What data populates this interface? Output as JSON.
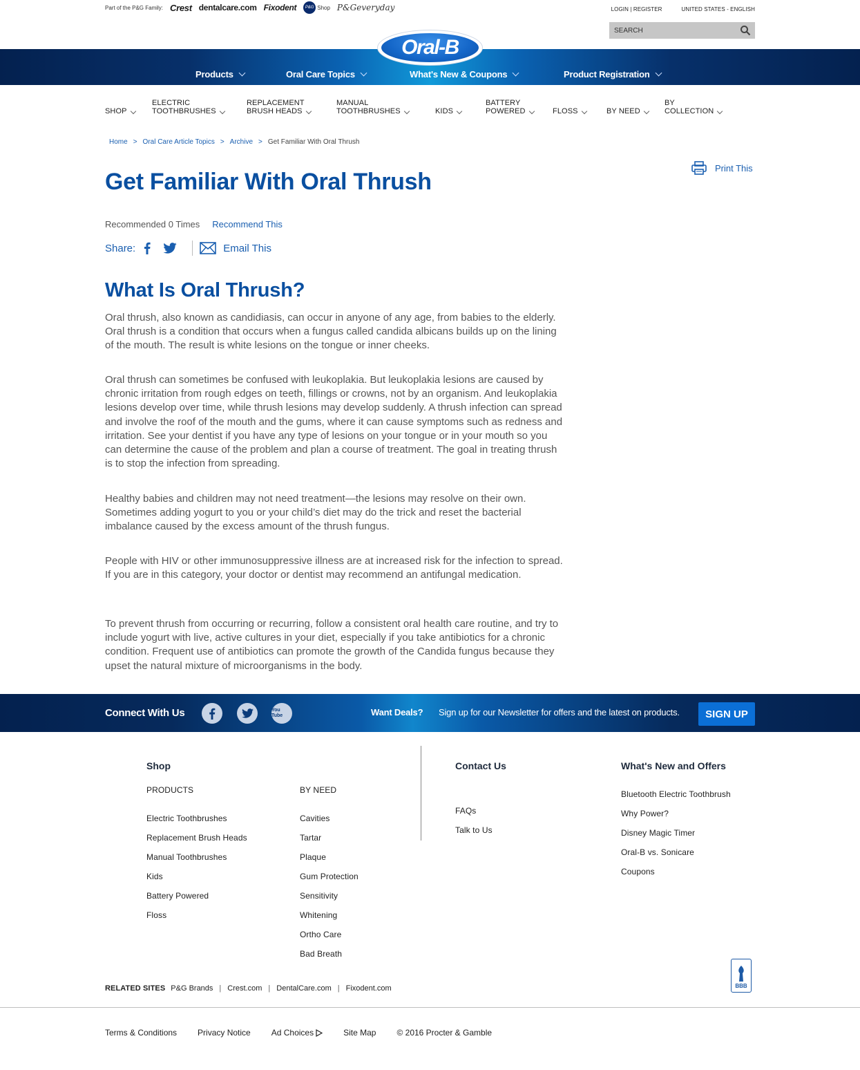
{
  "top": {
    "family_label": "Part of the P&G Family:",
    "brands": [
      "Crest",
      "dentalcare.com",
      "Fixodent",
      "P&G",
      "Shop",
      "P&Geveryday"
    ],
    "account": "LOGIN | REGISTER",
    "locale": "UNITED STATES - ENGLISH",
    "search_placeholder": "SEARCH"
  },
  "logo": {
    "text": "Oral-B"
  },
  "main_nav": [
    "Products",
    "Oral Care Topics",
    "What's New & Coupons",
    "Product Registration"
  ],
  "category_nav": [
    {
      "l1": "",
      "l2": "SHOP"
    },
    {
      "l1": "ELECTRIC",
      "l2": "TOOTHBRUSHES"
    },
    {
      "l1": "REPLACEMENT",
      "l2": "BRUSH HEADS"
    },
    {
      "l1": "MANUAL",
      "l2": "TOOTHBRUSHES"
    },
    {
      "l1": "",
      "l2": "KIDS"
    },
    {
      "l1": "BATTERY",
      "l2": "POWERED"
    },
    {
      "l1": "",
      "l2": "FLOSS"
    },
    {
      "l1": "",
      "l2": "BY NEED"
    },
    {
      "l1": "BY",
      "l2": "COLLECTION"
    }
  ],
  "breadcrumb": [
    "Home",
    "Oral Care Article Topics",
    "Archive",
    "Get Familiar With Oral Thrush"
  ],
  "print_label": "Print This",
  "article": {
    "title": "Get Familiar With Oral Thrush",
    "recommended": "Recommended 0 Times",
    "recommend_link": "Recommend This",
    "share_label": "Share:",
    "email_label": "Email This",
    "heading": "What Is Oral Thrush?",
    "paragraphs": [
      "Oral thrush, also known as candidiasis, can occur in anyone of any age, from babies to the elderly. Oral thrush is a condition that occurs when a fungus called candida albicans builds up on the lining of the mouth. The result is white lesions on the tongue or inner cheeks.",
      "Oral thrush can sometimes be confused with leukoplakia. But leukoplakia lesions are caused by chronic irritation from rough edges on teeth, fillings or crowns, not by an organism. And leukoplakia lesions develop over time, while thrush lesions may develop suddenly. A thrush infection can spread and involve the roof of the mouth and the gums, where it can cause symptoms such as redness and irritation. See your dentist if you have any type of lesions on your tongue or in your mouth so you can determine the cause of the problem and plan a course of treatment. The goal in treating thrush is to stop the infection from spreading.",
      "Healthy babies and children may not need treatment—the lesions may resolve on their own. Sometimes adding yogurt to you or your child’s diet may do the trick and reset the bacterial imbalance caused by the excess amount of the thrush fungus.",
      "People with HIV or other immunosuppressive illness are at increased risk for the infection to spread. If you are in this category, your doctor or dentist may recommend an antifungal medication.",
      "To prevent thrush from occurring or recurring, follow a consistent oral health care routine, and try to include yogurt with live, active cultures in your diet, especially if you take antibiotics for a chronic condition. Frequent use of antibiotics can promote the growth of the Candida fungus because they upset the natural mixture of microorganisms in the body."
    ]
  },
  "connect": {
    "label": "Connect With Us",
    "social": [
      "facebook-icon",
      "twitter-icon",
      "youtube-icon"
    ],
    "youtube_text": "You Tube",
    "deals": "Want Deals?",
    "newsletter": "Sign up for our Newsletter for offers and the latest on products.",
    "signup": "SIGN UP"
  },
  "footer": {
    "shop": "Shop",
    "products_label": "PRODUCTS",
    "products": [
      "Electric Toothbrushes",
      "Replacement Brush Heads",
      "Manual Toothbrushes",
      "Kids",
      "Battery Powered",
      "Floss"
    ],
    "byneed_label": "BY NEED",
    "byneed": [
      "Cavities",
      "Tartar",
      "Plaque",
      "Gum Protection",
      "Sensitivity",
      "Whitening",
      "Ortho Care",
      "Bad Breath"
    ],
    "contact": "Contact Us",
    "contact_links": [
      "FAQs",
      "Talk to Us"
    ],
    "whatsnew": "What's New and Offers",
    "whatsnew_links": [
      "Bluetooth Electric Toothbrush",
      "Why Power?",
      "Disney Magic Timer",
      "Oral-B vs. Sonicare",
      "Coupons"
    ],
    "bbb": "BBB",
    "related_label": "RELATED SITES",
    "related": [
      "P&G Brands",
      "Crest.com",
      "DentalCare.com",
      "Fixodent.com"
    ],
    "legal": [
      "Terms & Conditions",
      "Privacy Notice",
      "Ad Choices",
      "Site Map",
      "© 2016 Procter & Gamble"
    ]
  },
  "colors": {
    "brand_blue": "#0a4fa0",
    "link_blue": "#1a5fb0",
    "nav_dark": "#04214f",
    "signup": "#0b6fd6"
  }
}
